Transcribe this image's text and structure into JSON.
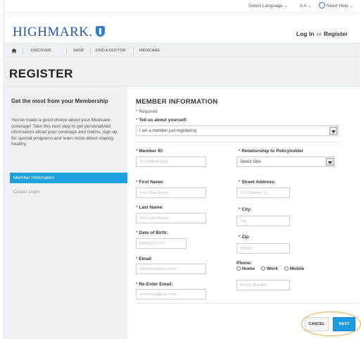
{
  "utility": {
    "language": "Select Language ⌄",
    "text_size": "A A ⌄",
    "help": "Need Help ⌄"
  },
  "header": {
    "logo": "HIGHMARK.",
    "login": "Log In",
    "or": "or",
    "register": "Register"
  },
  "nav": {
    "items": [
      "Discover",
      "Shop",
      "Find a Doctor",
      "Medicare"
    ]
  },
  "page_title": "REGISTER",
  "sidebar": {
    "title": "Get the most from your Membership",
    "description": "You've made a good choice about your Medicare coverage! Take this next step to get personalized information about your coverage and claims, sign up for special programs and learn more about staying healthy.",
    "steps": [
      "Member Information",
      "Create Login"
    ]
  },
  "form": {
    "title": "MEMBER INFORMATION",
    "required_note": "Required",
    "tell_us_label": "Tell us about yourself:",
    "tell_us_value": "I am a member just registering",
    "member_id_label": "Member ID:",
    "member_id_placeholder": "ID CARD#/SSN",
    "relationship_label": "Relationship to Policyholder",
    "relationship_value": "Select One",
    "first_name_label": "First Name:",
    "first_name_placeholder": "Your First Name",
    "street_label": "Street Address:",
    "street_placeholder": "123 Sample St.",
    "last_name_label": "Last Name:",
    "last_name_placeholder": "Your Last Name",
    "city_label": "City:",
    "city_placeholder": "City",
    "dob_label": "Date of Birth:",
    "dob_placeholder": "MM/DD/YYYY",
    "zip_label": "Zip:",
    "zip_placeholder": "55555",
    "email_label": "Email:",
    "email_placeholder": "youremail@xyz.com",
    "phone_label": "Phone:",
    "phone_types": [
      "Home",
      "Work",
      "Mobile"
    ],
    "reemail_label": "Re-Enter Email:",
    "reemail_placeholder": "youremail@xyz.com",
    "phone_placeholder": "Phone Number",
    "cancel": "CANCEL",
    "next": "NEXT"
  },
  "colors": {
    "accent": "#1fa0de",
    "brand": "#1d5aa0",
    "required": "#d0342c",
    "highlight": "#e8a54a"
  }
}
